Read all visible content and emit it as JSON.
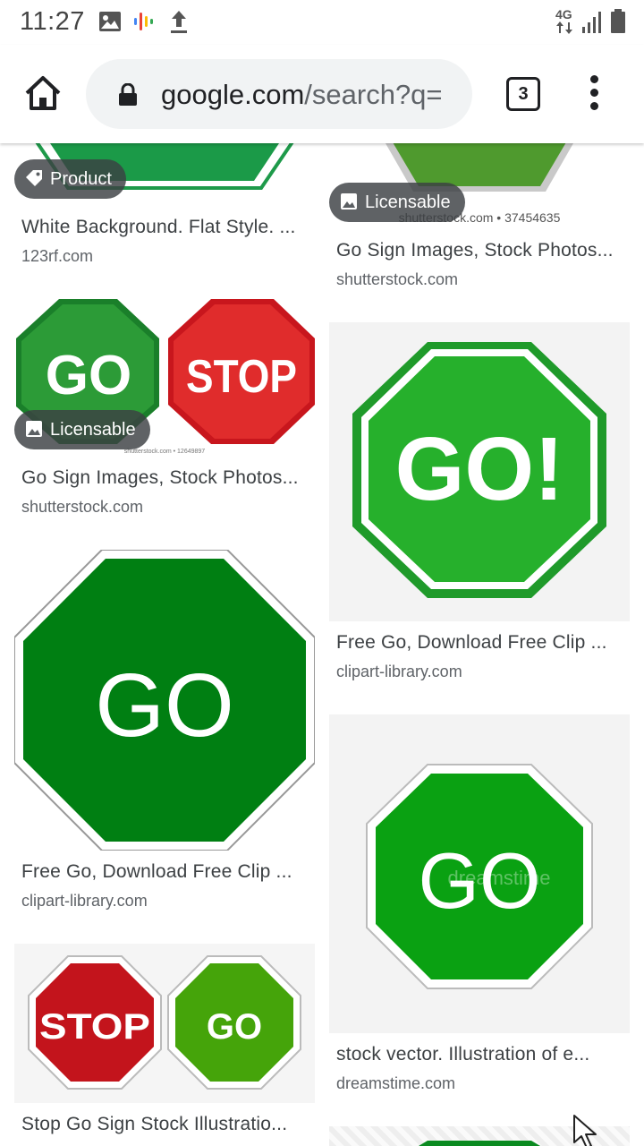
{
  "status_bar": {
    "time": "11:27",
    "network": "4G"
  },
  "browser": {
    "url_host": "google.com",
    "url_path": "/search?q=",
    "tab_count": "3"
  },
  "results": [
    {
      "badge": "Product",
      "title": "White Background. Flat Style. ...",
      "source": "123rf.com"
    },
    {
      "badge": "Licensable",
      "title": "Go Sign Images, Stock Photos...",
      "source": "shutterstock.com",
      "watermark": "shutterstock.com • 37454635"
    },
    {
      "badge": "Licensable",
      "title": "Go Sign Images, Stock Photos...",
      "source": "shutterstock.com",
      "watermark": "shutterstock.com • 12649897",
      "signs": [
        "GO",
        "STOP"
      ]
    },
    {
      "title": "Free Go, Download Free Clip ...",
      "source": "clipart-library.com",
      "sign": "GO!"
    },
    {
      "title": "Free Go, Download Free Clip ...",
      "source": "clipart-library.com",
      "sign": "GO"
    },
    {
      "title": "stock vector. Illustration of e...",
      "source": "dreamstime.com",
      "sign": "GO",
      "watermark": "dreamstime"
    },
    {
      "title": "Stop Go Sign Stock Illustratio...",
      "source": "",
      "signs": [
        "STOP",
        "GO"
      ]
    }
  ]
}
